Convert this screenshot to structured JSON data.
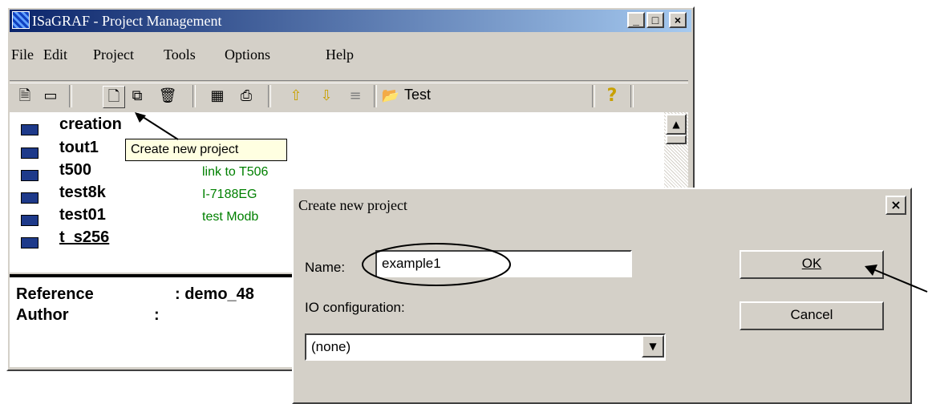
{
  "window": {
    "title": "ISaGRAF - Project Management",
    "controls": [
      "_",
      "□",
      "×"
    ]
  },
  "menu": [
    "File",
    "Edit",
    "Project",
    "Tools",
    "Options",
    "Help"
  ],
  "toolbar": {
    "icons": [
      "page-icon",
      "card-icon",
      "new-project-icon",
      "copy-icon",
      "delete-icon",
      "properties-icon",
      "print-icon",
      "arrow-up-icon",
      "arrow-down-icon",
      "list-icon",
      "folder-open-icon",
      "help-icon"
    ],
    "group_label": "Test",
    "help_glyph": "?"
  },
  "tooltip": "Create new project",
  "projects": [
    {
      "name": "creation",
      "comment": ""
    },
    {
      "name": "tout1",
      "comment": ""
    },
    {
      "name": "t500",
      "comment": "link to T506"
    },
    {
      "name": "test8k",
      "comment": "I-7188EG"
    },
    {
      "name": "test01",
      "comment": "test Modb"
    },
    {
      "name": "t_s256",
      "comment": ""
    }
  ],
  "info": {
    "reference_label": "Reference",
    "reference_value": ": demo_48",
    "author_label": "Author",
    "author_value": ":"
  },
  "dialog": {
    "title": "Create new project",
    "close": "×",
    "name_label": "Name:",
    "name_value": "example1",
    "io_label": "IO configuration:",
    "io_value": "(none)",
    "ok_label": "OK",
    "cancel_label": "Cancel"
  }
}
